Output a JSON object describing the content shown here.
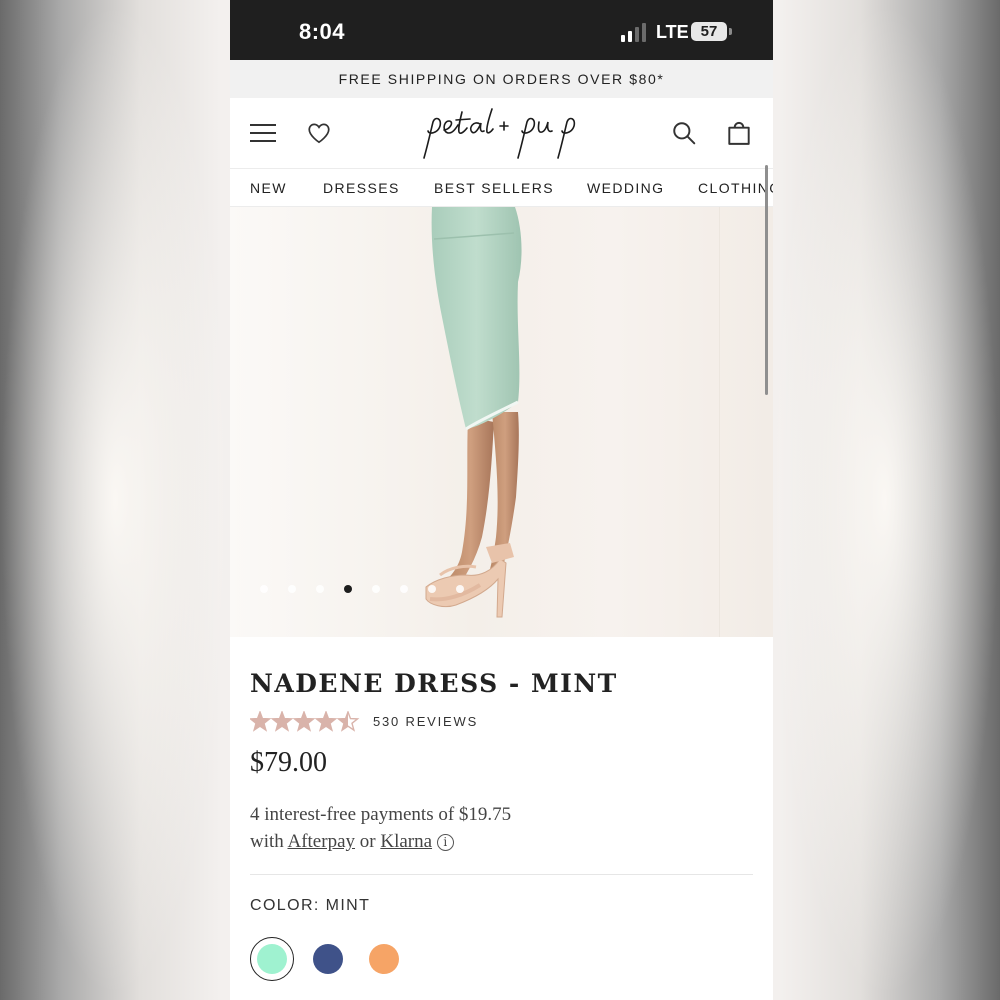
{
  "status_bar": {
    "time": "8:04",
    "network": "LTE",
    "battery": "57"
  },
  "promo": {
    "text": "FREE SHIPPING ON ORDERS OVER $80*"
  },
  "header": {
    "logo_text": "petal + pup"
  },
  "nav": {
    "items": [
      "NEW",
      "DRESSES",
      "BEST SELLERS",
      "WEDDING",
      "CLOTHING"
    ]
  },
  "gallery": {
    "image_count": 8,
    "active_index": 3
  },
  "product": {
    "title": "NADENE DRESS - MINT",
    "rating": 4.5,
    "rating_max": 5,
    "reviews": "530 REVIEWS",
    "price": "$79.00",
    "payment_line1": "4 interest-free payments of $19.75",
    "payment_with": "with",
    "payment_afterpay": "Afterpay",
    "payment_or": "or",
    "payment_klarna": "Klarna",
    "info_glyph": "i",
    "color_label": "COLOR: MINT",
    "swatches": [
      {
        "name": "mint",
        "color": "#9ff2d0",
        "selected": true
      },
      {
        "name": "navy",
        "color": "#3f5289",
        "selected": false
      },
      {
        "name": "orange",
        "color": "#f6a466",
        "selected": false
      }
    ],
    "star_color": "#d9b3aa"
  }
}
